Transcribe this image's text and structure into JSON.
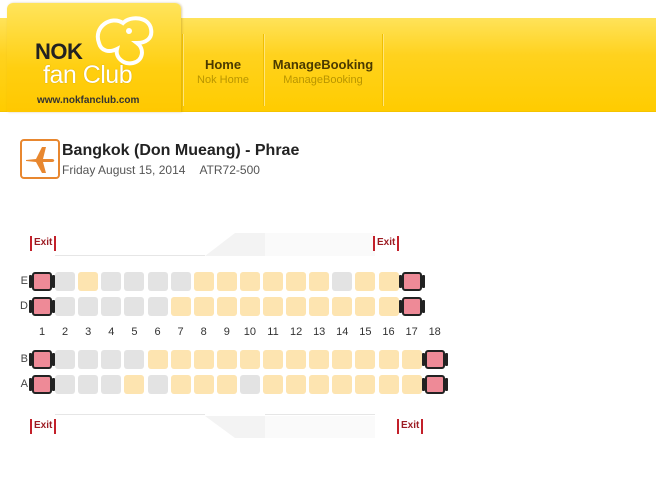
{
  "header": {
    "logo": {
      "line1": "NOK",
      "line2": "fan Club",
      "url": "www.nokfanclub.com"
    },
    "nav": [
      {
        "label": "Home",
        "sublabel": "Nok Home"
      },
      {
        "label": "ManageBooking",
        "sublabel": "ManageBooking"
      }
    ]
  },
  "flight": {
    "route": "Bangkok (Don Mueang) - Phrae",
    "date": "Friday August 15, 2014",
    "aircraft": "ATR72-500"
  },
  "seatmap": {
    "exit_label": "Exit",
    "columns": [
      "1",
      "2",
      "3",
      "4",
      "5",
      "6",
      "7",
      "8",
      "9",
      "10",
      "11",
      "12",
      "13",
      "14",
      "15",
      "16",
      "17",
      "18"
    ],
    "rows": [
      {
        "letter": "E",
        "seats": [
          "exit",
          "unavailable",
          "available",
          "unavailable",
          "unavailable",
          "unavailable",
          "unavailable",
          "available",
          "available",
          "available",
          "available",
          "available",
          "available",
          "unavailable",
          "available",
          "available",
          "exit",
          ""
        ]
      },
      {
        "letter": "D",
        "seats": [
          "exit",
          "unavailable",
          "unavailable",
          "unavailable",
          "unavailable",
          "unavailable",
          "available",
          "available",
          "available",
          "available",
          "available",
          "available",
          "available",
          "available",
          "available",
          "available",
          "exit",
          ""
        ]
      },
      {
        "letter": "B",
        "seats": [
          "exit",
          "unavailable",
          "unavailable",
          "unavailable",
          "unavailable",
          "available",
          "available",
          "available",
          "available",
          "available",
          "available",
          "available",
          "available",
          "available",
          "available",
          "available",
          "available",
          "exit"
        ]
      },
      {
        "letter": "A",
        "seats": [
          "exit",
          "unavailable",
          "unavailable",
          "unavailable",
          "available",
          "unavailable",
          "available",
          "available",
          "available",
          "unavailable",
          "available",
          "available",
          "available",
          "available",
          "available",
          "available",
          "available",
          "exit"
        ]
      }
    ]
  }
}
